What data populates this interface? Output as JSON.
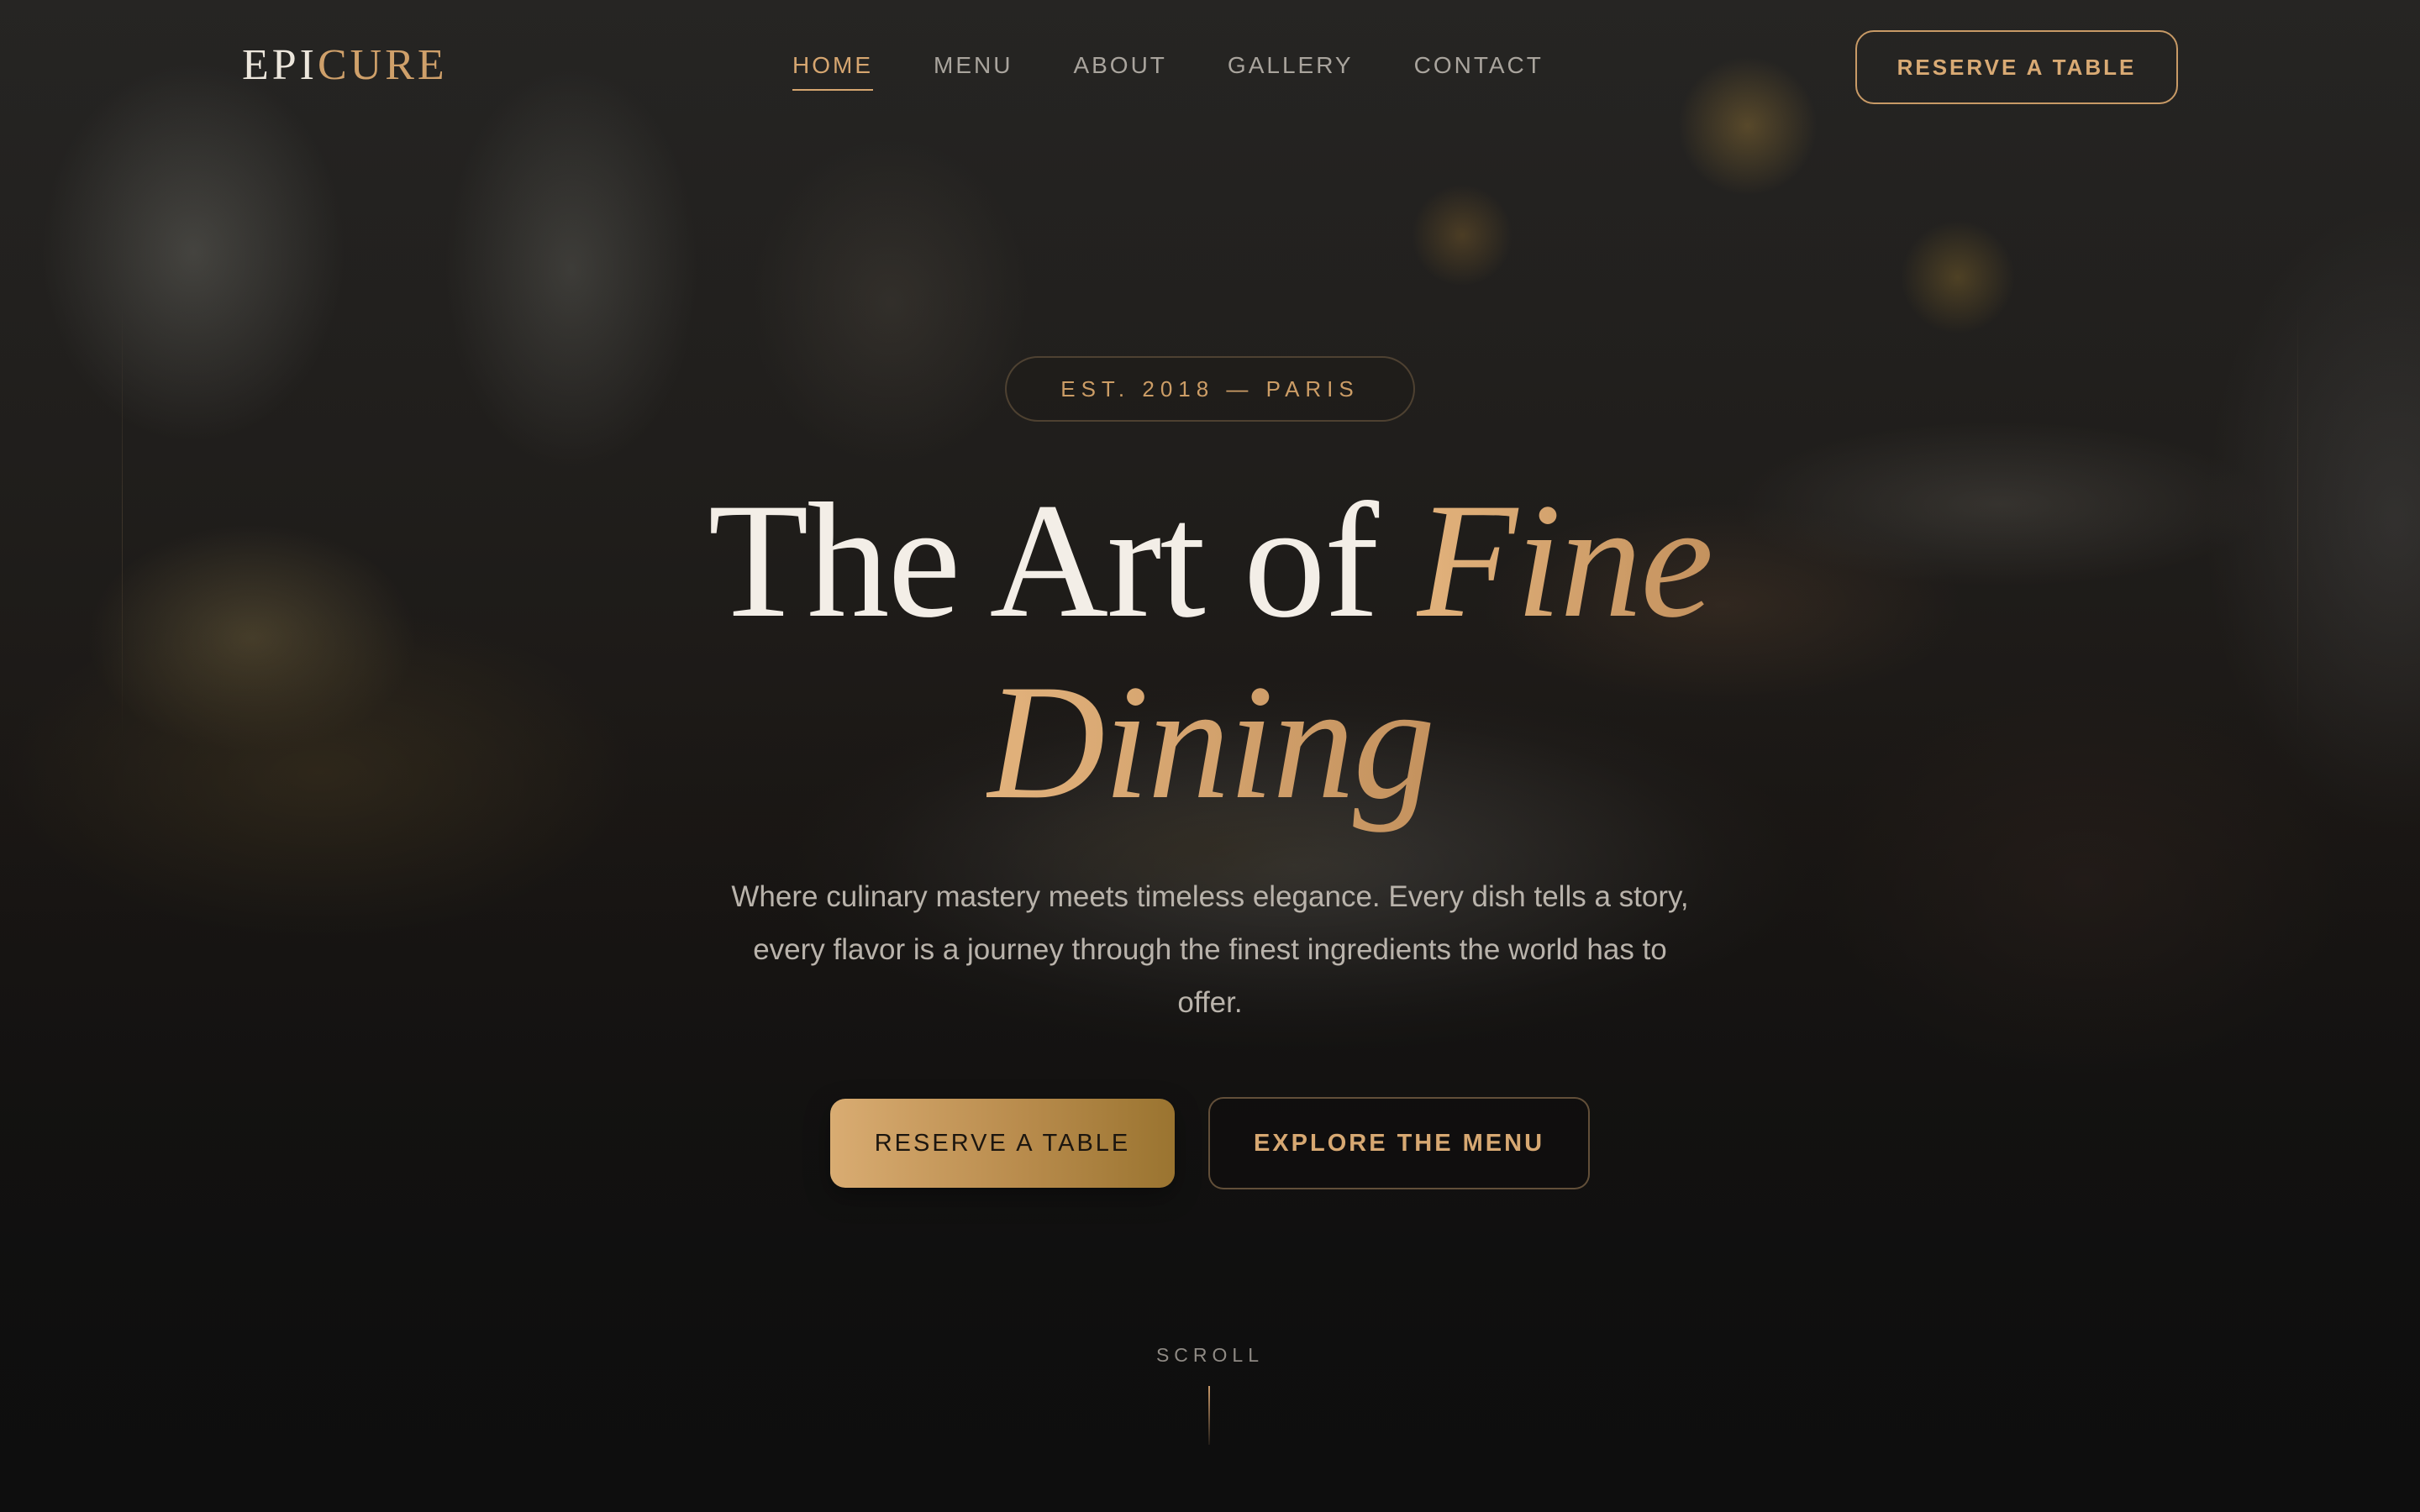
{
  "brand": {
    "logo_part1": "EPI",
    "logo_part2": "CURE"
  },
  "nav": {
    "items": [
      {
        "label": "HOME",
        "active": true
      },
      {
        "label": "MENU",
        "active": false
      },
      {
        "label": "ABOUT",
        "active": false
      },
      {
        "label": "GALLERY",
        "active": false
      },
      {
        "label": "CONTACT",
        "active": false
      }
    ],
    "cta_label": "RESERVE A TABLE"
  },
  "hero": {
    "badge": "EST. 2018 — PARIS",
    "headline_plain": "The Art of ",
    "headline_accent_1": "Fine",
    "headline_accent_2": "Dining",
    "description": "Where culinary mastery meets timeless elegance. Every dish tells a story, every flavor is a journey through the finest ingredients the world has to offer.",
    "primary_button": "RESERVE A TABLE",
    "secondary_button": "EXPLORE THE MENU"
  },
  "scroll": {
    "label": "SCROLL"
  },
  "colors": {
    "accent": "#d3a16c",
    "background": "#0f0f10",
    "text": "#f3eee7"
  }
}
